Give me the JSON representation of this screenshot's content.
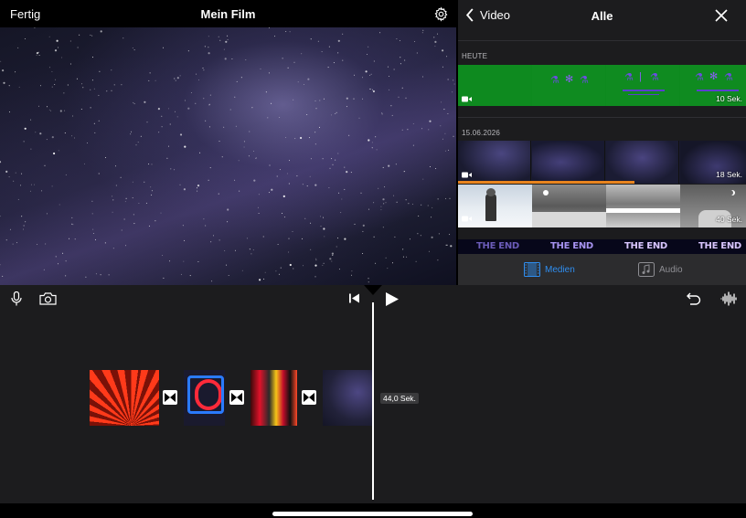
{
  "topbar": {
    "done_label": "Fertig",
    "title": "Mein Film"
  },
  "media_browser": {
    "back_label": "Video",
    "filter_title": "Alle",
    "sections": [
      {
        "label": "HEUTE",
        "clips": [
          {
            "duration": "10 Sek."
          }
        ]
      },
      {
        "label": "15.06.2026",
        "clips": [
          {
            "duration": "18 Sek."
          },
          {
            "duration": "40 Sek."
          }
        ]
      }
    ],
    "end_titles": [
      "THE END",
      "THE END",
      "THE END",
      "THE END"
    ],
    "tabs": [
      {
        "label": "Medien",
        "icon": "film-icon",
        "selected": true
      },
      {
        "label": "Audio",
        "icon": "music-note-icon",
        "selected": false
      }
    ]
  },
  "timeline": {
    "duration_label": "44,0 Sek."
  },
  "colors": {
    "accent": "#2f8ef0",
    "progress": "#e8841f",
    "green_clip": "#0d8a1e"
  }
}
